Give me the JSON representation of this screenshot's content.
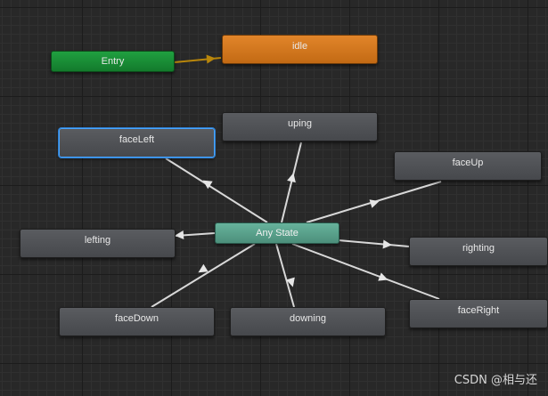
{
  "nodes": {
    "entry": "Entry",
    "idle": "idle",
    "any_state": "Any State",
    "face_left": "faceLeft",
    "uping": "uping",
    "face_up": "faceUp",
    "lefting": "lefting",
    "righting": "righting",
    "face_down": "faceDown",
    "downing": "downing",
    "face_right": "faceRight"
  },
  "watermark": "CSDN @相与还",
  "colors": {
    "entry": "#1a8f38",
    "default_state": "#d97a20",
    "any_state": "#5ca28d",
    "state": "#4f5155",
    "selected_outline": "#4aa6ff",
    "transition": "#d8d8d8",
    "entry_transition": "#b8860b",
    "background": "#282828"
  }
}
